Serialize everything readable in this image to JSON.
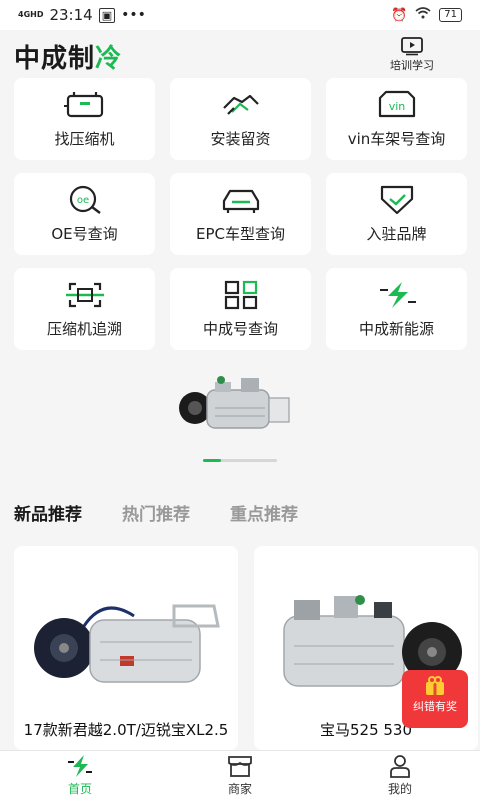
{
  "status_bar": {
    "network": "4GHD",
    "time": "23:14",
    "battery": "71"
  },
  "header": {
    "logo_main": "中成制",
    "logo_accent": "冷",
    "training_label": "培训学习"
  },
  "grid": [
    {
      "label": "找压缩机",
      "icon": "compressor-icon"
    },
    {
      "label": "安装留资",
      "icon": "handshake-icon"
    },
    {
      "label": "vin车架号查询",
      "icon": "vin-icon"
    },
    {
      "label": "OE号查询",
      "icon": "oe-search-icon"
    },
    {
      "label": "EPC车型查询",
      "icon": "car-icon"
    },
    {
      "label": "入驻品牌",
      "icon": "brand-shield-icon"
    },
    {
      "label": "压缩机追溯",
      "icon": "trace-scan-icon"
    },
    {
      "label": "中成号查询",
      "icon": "grid-blocks-icon"
    },
    {
      "label": "中成新能源",
      "icon": "lightning-icon"
    }
  ],
  "banner": {
    "image": "compressor-product-image",
    "slide_index": 1
  },
  "tabs": [
    {
      "label": "新品推荐",
      "active": true
    },
    {
      "label": "热门推荐",
      "active": false
    },
    {
      "label": "重点推荐",
      "active": false
    }
  ],
  "products": [
    {
      "name": "17款新君越2.0T/迈锐宝XL2.5"
    },
    {
      "name": "宝马525 530"
    }
  ],
  "float_badge": {
    "label": "纠错有奖"
  },
  "bottom_nav": [
    {
      "label": "首页",
      "icon": "home-bolt-icon",
      "active": true
    },
    {
      "label": "商家",
      "icon": "store-icon",
      "active": false
    },
    {
      "label": "我的",
      "icon": "user-icon",
      "active": false
    }
  ],
  "colors": {
    "accent": "#1db954",
    "badge": "#f0383a"
  }
}
